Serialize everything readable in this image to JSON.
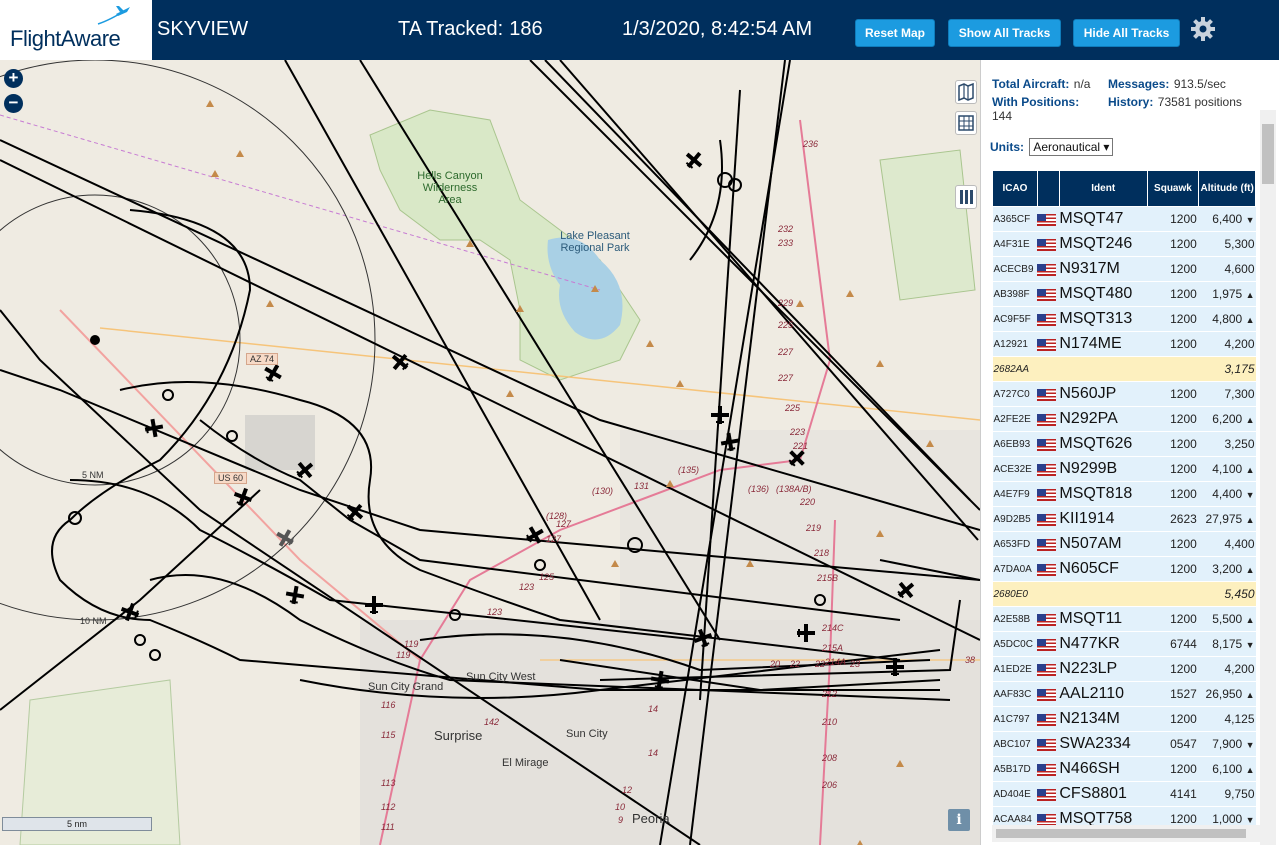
{
  "header": {
    "logo_text": "FlightAware",
    "app_title": "SKYVIEW",
    "ta_tracked_label": "TA Tracked:",
    "ta_tracked_value": "186",
    "clock": "1/3/2020, 8:42:54 AM",
    "buttons": {
      "reset": "Reset Map",
      "show": "Show All Tracks",
      "hide": "Hide All Tracks"
    },
    "settings_icon": "gear-icon",
    "colors": {
      "bar": "#002f5d",
      "button": "#1c9be0"
    }
  },
  "map": {
    "zoom_in": "+",
    "zoom_out": "−",
    "scale_label": "5 nm",
    "info_label": "i",
    "labels": {
      "hells_canyon": "Hells Canyon Wilderness Area",
      "lake_pleasant": "Lake Pleasant Regional Park",
      "sun_city_grand": "Sun City Grand",
      "sun_city_west": "Sun City West",
      "surprise": "Surprise",
      "sun_city": "Sun City",
      "el_mirage": "El Mirage",
      "peoria": "Peoria",
      "ring_5nm": "5 NM",
      "ring_10nm": "10 NM",
      "az74": "AZ 74",
      "us60": "US 60"
    },
    "route_numbers": [
      "236",
      "232",
      "233",
      "229",
      "225",
      "227",
      "227",
      "225",
      "223",
      "221",
      "220",
      "219",
      "218",
      "215B",
      "214C",
      "215A",
      "214A",
      "212",
      "210",
      "208",
      "206",
      "(130)",
      "131",
      "(128)",
      "127",
      "127",
      "125",
      "123",
      "123",
      "119",
      "119",
      "116",
      "115",
      "113",
      "112",
      "111",
      "142",
      "14",
      "14",
      "12",
      "10",
      "9",
      "(135)",
      "(136)",
      "(138A/B)",
      "22",
      "22",
      "23",
      "20",
      "38"
    ]
  },
  "panel": {
    "total_aircraft_label": "Total Aircraft:",
    "total_aircraft_value": "n/a",
    "messages_label": "Messages:",
    "messages_value": "913.5/sec",
    "with_positions_label": "With Positions:",
    "with_positions_value": "144",
    "history_label": "History:",
    "history_value": "73581 positions",
    "units_label": "Units:",
    "units_value": "Aeronautical",
    "columns": [
      "ICAO",
      "",
      "Ident",
      "Squawk",
      "Altitude (ft)"
    ],
    "rows": [
      {
        "icao": "A365CF",
        "flag": true,
        "ident": "MSQT47",
        "squawk": "1200",
        "alt": "6,400",
        "trend": "▼",
        "highlight": false
      },
      {
        "icao": "A4F31E",
        "flag": true,
        "ident": "MSQT246",
        "squawk": "1200",
        "alt": "5,300",
        "trend": "",
        "highlight": false
      },
      {
        "icao": "ACECB9",
        "flag": true,
        "ident": "N9317M",
        "squawk": "1200",
        "alt": "4,600",
        "trend": "",
        "highlight": false
      },
      {
        "icao": "AB398F",
        "flag": true,
        "ident": "MSQT480",
        "squawk": "1200",
        "alt": "1,975",
        "trend": "▲",
        "highlight": false
      },
      {
        "icao": "AC9F5F",
        "flag": true,
        "ident": "MSQT313",
        "squawk": "1200",
        "alt": "4,800",
        "trend": "▲",
        "highlight": false
      },
      {
        "icao": "A12921",
        "flag": true,
        "ident": "N174ME",
        "squawk": "1200",
        "alt": "4,200",
        "trend": "",
        "highlight": false
      },
      {
        "icao": "2682AA",
        "flag": false,
        "ident": "",
        "squawk": "",
        "alt": "3,175",
        "trend": "",
        "highlight": true
      },
      {
        "icao": "A727C0",
        "flag": true,
        "ident": "N560JP",
        "squawk": "1200",
        "alt": "7,300",
        "trend": "",
        "highlight": false
      },
      {
        "icao": "A2FE2E",
        "flag": true,
        "ident": "N292PA",
        "squawk": "1200",
        "alt": "6,200",
        "trend": "▲",
        "highlight": false
      },
      {
        "icao": "A6EB93",
        "flag": true,
        "ident": "MSQT626",
        "squawk": "1200",
        "alt": "3,250",
        "trend": "",
        "highlight": false
      },
      {
        "icao": "ACE32E",
        "flag": true,
        "ident": "N9299B",
        "squawk": "1200",
        "alt": "4,100",
        "trend": "▲",
        "highlight": false
      },
      {
        "icao": "A4E7F9",
        "flag": true,
        "ident": "MSQT818",
        "squawk": "1200",
        "alt": "4,400",
        "trend": "▼",
        "highlight": false
      },
      {
        "icao": "A9D2B5",
        "flag": true,
        "ident": "KII1914",
        "squawk": "2623",
        "alt": "27,975",
        "trend": "▲",
        "highlight": false
      },
      {
        "icao": "A653FD",
        "flag": true,
        "ident": "N507AM",
        "squawk": "1200",
        "alt": "4,400",
        "trend": "",
        "highlight": false
      },
      {
        "icao": "A7DA0A",
        "flag": true,
        "ident": "N605CF",
        "squawk": "1200",
        "alt": "3,200",
        "trend": "▲",
        "highlight": false
      },
      {
        "icao": "2680E0",
        "flag": false,
        "ident": "",
        "squawk": "",
        "alt": "5,450",
        "trend": "",
        "highlight": true
      },
      {
        "icao": "A2E58B",
        "flag": true,
        "ident": "MSQT11",
        "squawk": "1200",
        "alt": "5,500",
        "trend": "▲",
        "highlight": false
      },
      {
        "icao": "A5DC0C",
        "flag": true,
        "ident": "N477KR",
        "squawk": "6744",
        "alt": "8,175",
        "trend": "▼",
        "highlight": false
      },
      {
        "icao": "A1ED2E",
        "flag": true,
        "ident": "N223LP",
        "squawk": "1200",
        "alt": "4,200",
        "trend": "",
        "highlight": false
      },
      {
        "icao": "AAF83C",
        "flag": true,
        "ident": "AAL2110",
        "squawk": "1527",
        "alt": "26,950",
        "trend": "▲",
        "highlight": false
      },
      {
        "icao": "A1C797",
        "flag": true,
        "ident": "N2134M",
        "squawk": "1200",
        "alt": "4,125",
        "trend": "",
        "highlight": false
      },
      {
        "icao": "ABC107",
        "flag": true,
        "ident": "SWA2334",
        "squawk": "0547",
        "alt": "7,900",
        "trend": "▼",
        "highlight": false
      },
      {
        "icao": "A5B17D",
        "flag": true,
        "ident": "N466SH",
        "squawk": "1200",
        "alt": "6,100",
        "trend": "▲",
        "highlight": false
      },
      {
        "icao": "AD404E",
        "flag": true,
        "ident": "CFS8801",
        "squawk": "4141",
        "alt": "9,750",
        "trend": "",
        "highlight": false
      },
      {
        "icao": "ACAA84",
        "flag": true,
        "ident": "MSQT758",
        "squawk": "1200",
        "alt": "1,000",
        "trend": "▼",
        "highlight": false
      }
    ]
  }
}
